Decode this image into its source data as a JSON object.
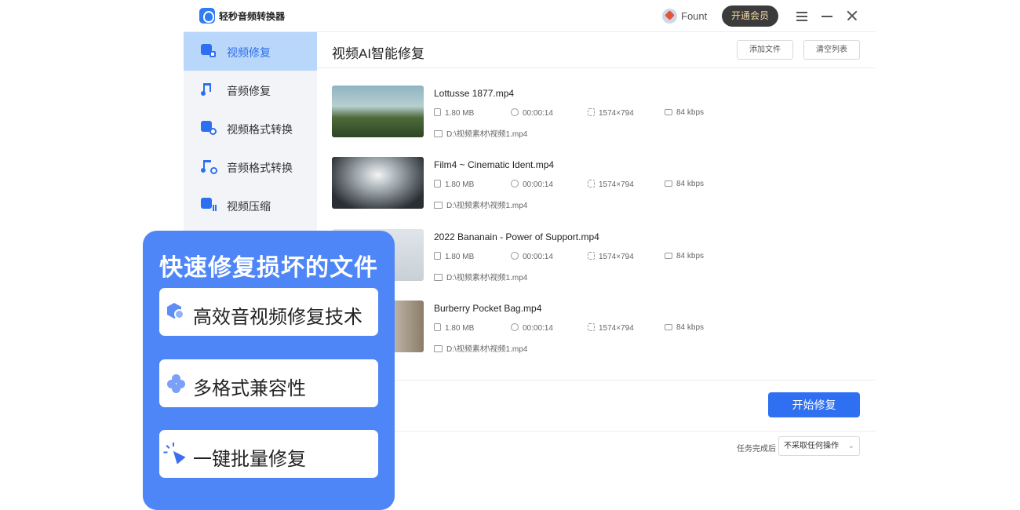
{
  "app": {
    "title": "轻秒音频转换器",
    "user_name": "Fount",
    "vip_label": "开通会员"
  },
  "sidebar": {
    "items": [
      {
        "label": "视频修复",
        "active": true
      },
      {
        "label": "音频修复",
        "active": false
      },
      {
        "label": "视频格式转换",
        "active": false
      },
      {
        "label": "音频格式转换",
        "active": false
      },
      {
        "label": "视频压缩",
        "active": false
      }
    ]
  },
  "main": {
    "title": "视频AI智能修复",
    "add_file_label": "添加文件",
    "clear_list_label": "清空列表",
    "files": [
      {
        "name": "Lottusse 1877.mp4",
        "size": "1.80 MB",
        "duration": "00:00:14",
        "resolution": "1574×794",
        "bitrate": "84 kbps",
        "path": "D:\\视频素材\\视频1.mp4"
      },
      {
        "name": "Film4 ~ Cinematic Ident.mp4",
        "size": "1.80 MB",
        "duration": "00:00:14",
        "resolution": "1574×794",
        "bitrate": "84 kbps",
        "path": "D:\\视频素材\\视频1.mp4"
      },
      {
        "name": "2022 Bananain - Power of Support.mp4",
        "size": "1.80 MB",
        "duration": "00:00:14",
        "resolution": "1574×794",
        "bitrate": "84 kbps",
        "path": "D:\\视频素材\\视频1.mp4"
      },
      {
        "name": "Burberry Pocket Bag.mp4",
        "size": "1.80 MB",
        "duration": "00:00:14",
        "resolution": "1574×794",
        "bitrate": "84 kbps",
        "path": "D:\\视频素材\\视频1.mp4"
      }
    ],
    "start_label": "开始修复",
    "after_task_label": "任务完成后",
    "after_task_value": "不采取任何操作"
  },
  "promo": {
    "title": "快速修复损坏的文件",
    "features": [
      "高效音视频修复技术",
      "多格式兼容性",
      "一键批量修复"
    ]
  },
  "colors": {
    "accent": "#2f6ff2",
    "sidebar_active": "#b9d6fb",
    "promo_bg": "#4f86f7"
  }
}
